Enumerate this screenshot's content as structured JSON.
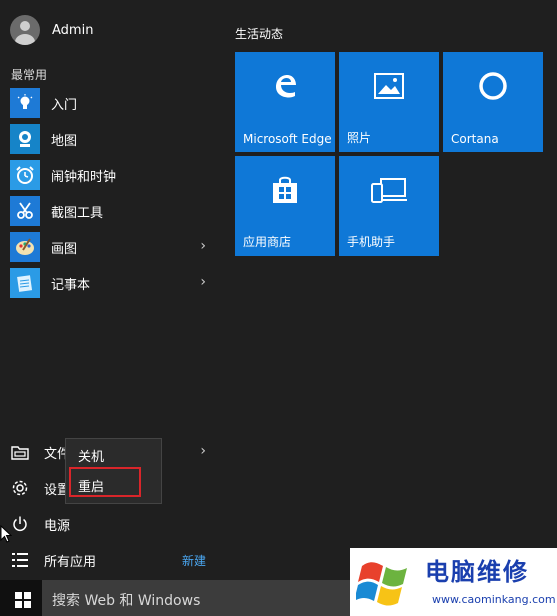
{
  "user": {
    "name": "Admin"
  },
  "most_used": {
    "title": "最常用",
    "apps": [
      {
        "label": "入门",
        "icon": "lightbulb-icon",
        "has_submenu": false
      },
      {
        "label": "地图",
        "icon": "map-camera-icon",
        "has_submenu": false
      },
      {
        "label": "闹钟和时钟",
        "icon": "alarm-clock-icon",
        "has_submenu": false
      },
      {
        "label": "截图工具",
        "icon": "scissors-icon",
        "has_submenu": false
      },
      {
        "label": "画图",
        "icon": "paint-palette-icon",
        "has_submenu": true
      },
      {
        "label": "记事本",
        "icon": "notepad-icon",
        "has_submenu": true
      }
    ]
  },
  "bottom": {
    "file_explorer": "文件资源管理器",
    "settings": "设置",
    "power": "电源",
    "all_apps": "所有应用",
    "new_badge": "新建"
  },
  "power_menu": {
    "shutdown": "关机",
    "restart": "重启"
  },
  "tiles": {
    "title": "生活动态",
    "items": [
      {
        "label": "Microsoft Edge",
        "icon": "edge-icon"
      },
      {
        "label": "照片",
        "icon": "photos-icon"
      },
      {
        "label": "Cortana",
        "icon": "cortana-icon"
      },
      {
        "label": "应用商店",
        "icon": "store-icon"
      },
      {
        "label": "手机助手",
        "icon": "phone-companion-icon"
      }
    ],
    "color": "#0f78d7"
  },
  "taskbar": {
    "search_placeholder": "搜索 Web 和 Windows"
  },
  "watermark": {
    "title": "电脑维修",
    "url": "www.caominkang.com"
  },
  "colors": {
    "accent": "#0f78d7",
    "highlight_border": "#d9252a",
    "new_badge": "#4aa6f0"
  }
}
